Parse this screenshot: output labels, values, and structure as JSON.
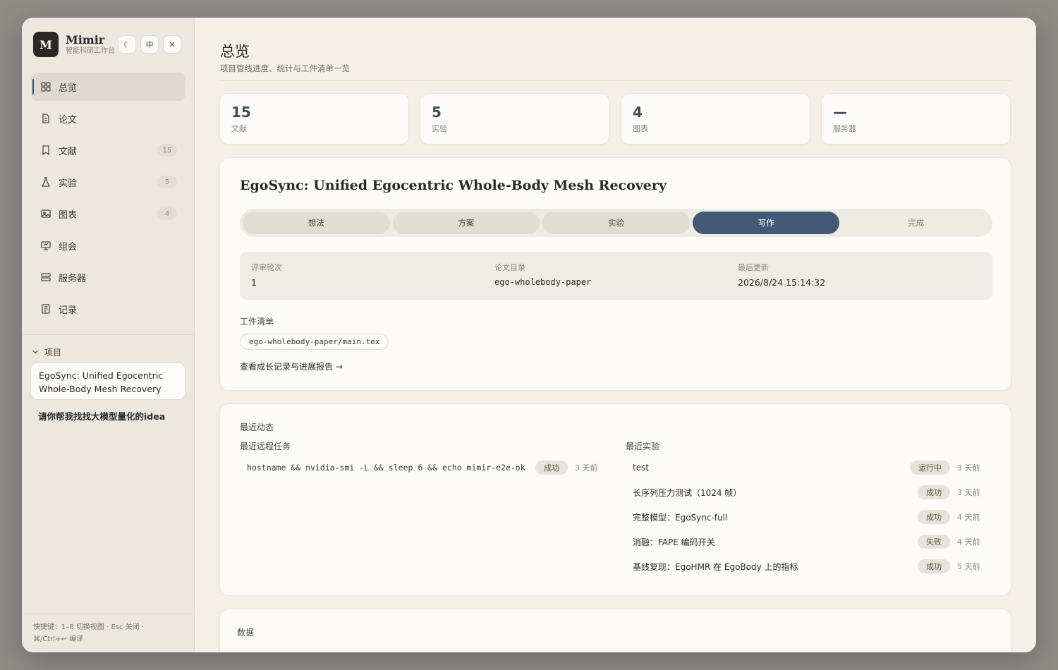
{
  "brand": {
    "logo_letter": "M",
    "name": "Mimir",
    "subtitle": "智能科研工作台"
  },
  "top_buttons": {
    "theme": "☾",
    "lang": "中",
    "close": "✕"
  },
  "nav": [
    {
      "label": "总览",
      "icon": "grid-icon",
      "badge": "",
      "active": true
    },
    {
      "label": "论文",
      "icon": "document-icon",
      "badge": ""
    },
    {
      "label": "文献",
      "icon": "bookmark-icon",
      "badge": "15"
    },
    {
      "label": "实验",
      "icon": "flask-icon",
      "badge": "5"
    },
    {
      "label": "图表",
      "icon": "image-icon",
      "badge": "4"
    },
    {
      "label": "组会",
      "icon": "presentation-icon",
      "badge": ""
    },
    {
      "label": "服务器",
      "icon": "server-icon",
      "badge": ""
    },
    {
      "label": "记录",
      "icon": "notes-icon",
      "badge": ""
    }
  ],
  "projects": {
    "header": "项目",
    "items": [
      "EgoSync: Unified Egocentric Whole-Body Mesh Recovery",
      "请你帮我找找大模型量化的idea"
    ]
  },
  "shortcut_hint": "快捷键：1–8 切换视图 · Esc 关闭 · ⌘/Ctrl+↩ 编译",
  "page": {
    "title": "总览",
    "subtitle": "项目管线进度、统计与工件清单一览"
  },
  "stats": [
    {
      "value": "15",
      "label": "文献"
    },
    {
      "value": "5",
      "label": "实验"
    },
    {
      "value": "4",
      "label": "图表"
    },
    {
      "value": "—",
      "label": "服务器"
    }
  ],
  "project_card": {
    "title": "EgoSync: Unified Egocentric Whole-Body Mesh Recovery",
    "stages": [
      "想法",
      "方案",
      "实验",
      "写作",
      "完成"
    ],
    "active_stage": "写作",
    "meta": [
      {
        "label": "评审轮次",
        "value": "1"
      },
      {
        "label": "论文目录",
        "value": "ego-wholebody-paper"
      },
      {
        "label": "最后更新",
        "value": "2026/8/24 15:14:32"
      }
    ],
    "artifacts_label": "工件清单",
    "artifact": "ego-wholebody-paper/main.tex",
    "report_link": "查看成长记录与进展报告 →"
  },
  "recent": {
    "title": "最近动态",
    "tasks_title": "最近远程任务",
    "tasks": [
      {
        "cmd": "hostname && nvidia-smi -L && sleep 6 && echo mimir-e2e-ok",
        "status": "成功",
        "time": "3 天前"
      }
    ],
    "experiments_title": "最近实验",
    "experiments": [
      {
        "name": "test",
        "status": "运行中",
        "time": "3 天前"
      },
      {
        "name": "长序列压力测试（1024 帧）",
        "status": "成功",
        "time": "3 天前"
      },
      {
        "name": "完整模型：EgoSync-full",
        "status": "成功",
        "time": "4 天前"
      },
      {
        "name": "消融：FAPE 编码开关",
        "status": "失败",
        "time": "4 天前"
      },
      {
        "name": "基线复现：EgoHMR 在 EgoBody 上的指标",
        "status": "成功",
        "time": "5 天前"
      }
    ]
  },
  "data_section": {
    "title": "数据"
  }
}
